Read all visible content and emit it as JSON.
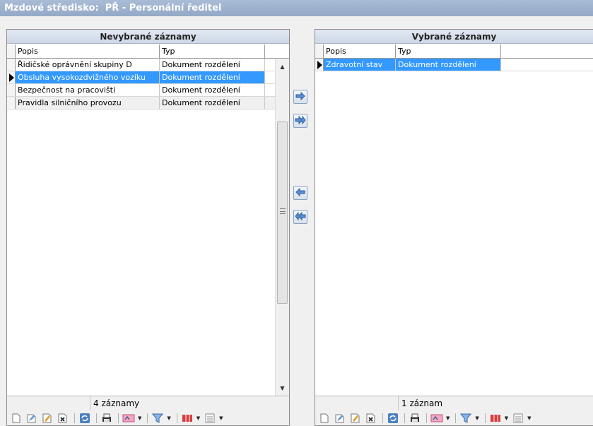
{
  "title": {
    "label": "Mzdové středisko:",
    "value": "PŘ  -  Personální ředitel"
  },
  "left_panel": {
    "header": "Nevybrané záznamy",
    "columns": [
      "Popis",
      "Typ"
    ],
    "rows": [
      {
        "popis": "Řidičské oprávnění skupiny D",
        "typ": "Dokument rozdělení"
      },
      {
        "popis": "Obsluha vysokozdvižného vozíku",
        "typ": "Dokument rozdělení"
      },
      {
        "popis": "Bezpečnost na pracovišti",
        "typ": "Dokument rozdělení"
      },
      {
        "popis": "Pravidla silničního provozu",
        "typ": "Dokument rozdělení"
      }
    ],
    "count": "4 záznamy"
  },
  "right_panel": {
    "header": "Vybrané záznamy",
    "columns": [
      "Popis",
      "Typ"
    ],
    "rows": [
      {
        "popis": "Zdravotní stav",
        "typ": "Dokument rozdělení"
      }
    ],
    "count": "1 záznam"
  },
  "colors": {
    "titlebar": "#a2b5d0",
    "selection": "#3399ff",
    "accent": "#4a7fc0"
  },
  "icons": {
    "move_buttons": [
      "move-right-icon",
      "move-all-right-icon",
      "move-left-icon",
      "move-all-left-icon"
    ],
    "toolbar": [
      "new-icon",
      "edit-icon",
      "properties-icon",
      "delete-icon",
      "refresh-icon",
      "print-icon",
      "sort-icon",
      "filter-icon",
      "columns-icon",
      "export-icon"
    ]
  }
}
